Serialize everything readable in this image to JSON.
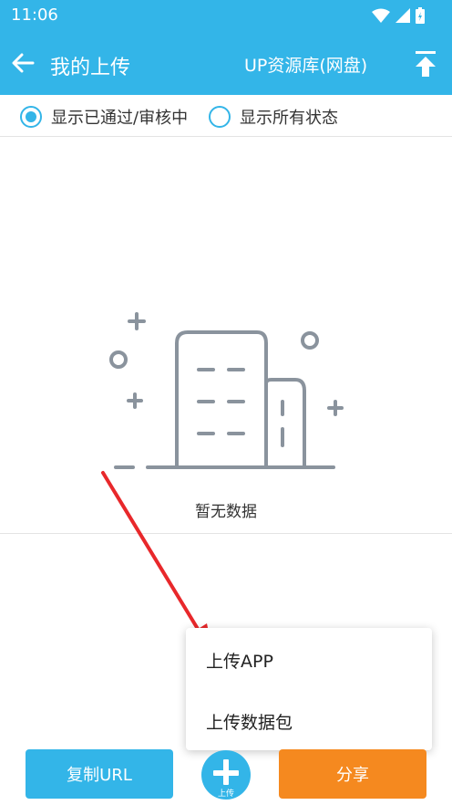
{
  "status_bar": {
    "time": "11:06"
  },
  "toolbar": {
    "title": "我的上传",
    "action_label": "UP资源库(网盘)",
    "back_icon": "arrow-left-icon",
    "upload_icon": "upload-icon"
  },
  "filters": [
    {
      "label": "显示已通过/审核中",
      "selected": true
    },
    {
      "label": "显示所有状态",
      "selected": false
    }
  ],
  "empty_state": {
    "message": "暂无数据",
    "icon": "empty-buildings-illustration"
  },
  "popup_menu": {
    "items": [
      {
        "label": "上传APP"
      },
      {
        "label": "上传数据包"
      }
    ]
  },
  "bottom_bar": {
    "copy_label": "复制URL",
    "fab_label": "上传",
    "share_label": "分享"
  },
  "colors": {
    "accent": "#33b5e8",
    "share": "#f5891f",
    "arrow": "#e8282b"
  }
}
